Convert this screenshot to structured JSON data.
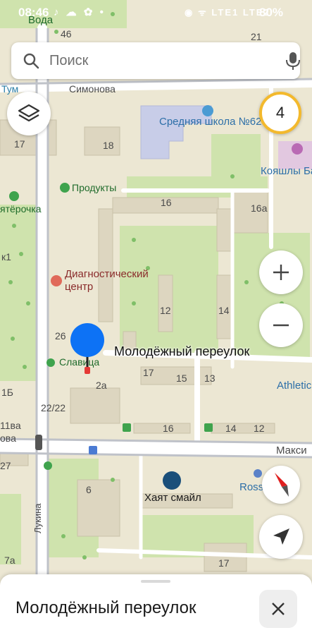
{
  "status_bar": {
    "time": "08:46",
    "left_icons": "♪ ☁ ✿ •",
    "right_icons": "◉ ᯤ LTE1 LTE2",
    "battery": "80%"
  },
  "search": {
    "placeholder": "Поиск"
  },
  "traffic_level": "4",
  "map": {
    "labels": {
      "voda": "Вода",
      "num46": "46",
      "num21": "21",
      "tum": "Тум",
      "simonova": "Симонова",
      "school": "Средняя школа №62",
      "num17a": "17",
      "num18": "18",
      "koyashly": "Кояшлы Ба",
      "produkty": "Продукты",
      "pyaterochka": "ятёрочка",
      "num16a": "16",
      "num16a_b": "16а",
      "k1": "к1",
      "diag1": "Диагностический",
      "diag2": "центр",
      "num12a": "12",
      "num14a": "14",
      "num26": "26",
      "street": "Молодёжный переулок",
      "slavitsa": "Славица",
      "num17b": "17",
      "num15": "15",
      "num13": "13",
      "athletic": "Athletic",
      "num1b": "1Б",
      "num2a": "2а",
      "num2222": "22/22",
      "num11v": "11ва",
      "ova": "ова",
      "num16b": "16",
      "num14b": "14",
      "num12b": "12",
      "maksi": "Макси",
      "num27": "27",
      "num6": "6",
      "ross": "Ross",
      "khayat": "Хаят смайл",
      "lukina": "Лукина",
      "num7a": "7а",
      "num17c": "17"
    }
  },
  "bottom_sheet": {
    "title": "Молодёжный переулок"
  },
  "colors": {
    "map_bg": "#ece7d3",
    "road": "#ffffff",
    "park": "#cfe3ad",
    "building": "#ddd6c0",
    "marker": "#0d72f5",
    "traffic_ring": "#f3b92d",
    "compass_red": "#e02020"
  }
}
